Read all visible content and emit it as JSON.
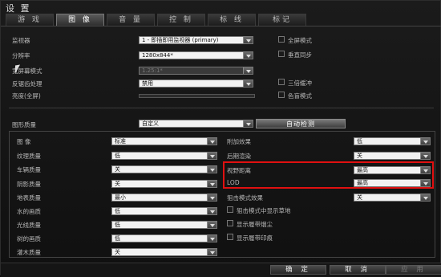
{
  "window": {
    "title": "设 置"
  },
  "tabs": [
    {
      "label": "游 戏"
    },
    {
      "label": "图 像"
    },
    {
      "label": "音 量"
    },
    {
      "label": "控 制"
    },
    {
      "label": "标 线"
    },
    {
      "label": "标记"
    }
  ],
  "display": {
    "monitor": {
      "label": "监视器",
      "value": "1 - 即插即用监视器 (primary)"
    },
    "resolution": {
      "label": "分辨率",
      "value": "1280x844*"
    },
    "aspect": {
      "label": "宽屏幕模式",
      "value": "1.25:1*"
    },
    "antialias": {
      "label": "反锯齿处理",
      "value": "禁用"
    },
    "brightness": {
      "label": "亮度(全屏)"
    },
    "fullscreen": {
      "label": "全屏模式"
    },
    "vsync": {
      "label": "垂直同步"
    },
    "triple": {
      "label": "三倍缓冲"
    },
    "colorblind": {
      "label": "色盲模式"
    }
  },
  "quality": {
    "label": "图形质量",
    "value": "自定义",
    "auto_button": "自动检测"
  },
  "left_settings": [
    {
      "label": "图 像",
      "value": "标准"
    },
    {
      "label": "纹理质量",
      "value": "低"
    },
    {
      "label": "车辆质量",
      "value": "关"
    },
    {
      "label": "阴影质量",
      "value": "关"
    },
    {
      "label": "地表质量",
      "value": "最小"
    },
    {
      "label": "水的画质",
      "value": "低"
    },
    {
      "label": "光线质量",
      "value": "低"
    },
    {
      "label": "树的画质",
      "value": "低"
    },
    {
      "label": "灌木质量",
      "value": "关"
    }
  ],
  "right_settings": [
    {
      "label": "附加效果",
      "value": "低"
    },
    {
      "label": "后期渲染",
      "value": "关"
    },
    {
      "label": "视野距离",
      "value": "最高"
    },
    {
      "label": "LOD",
      "value": "最高"
    },
    {
      "label": "狙击模式效果",
      "value": "关"
    }
  ],
  "right_checks": [
    {
      "label": "狙击模式中显示草地"
    },
    {
      "label": "显示履带烟尘"
    },
    {
      "label": "显示履带印痕"
    }
  ],
  "footer": {
    "ok": "确 定",
    "cancel": "取 消",
    "apply": "应 用"
  }
}
